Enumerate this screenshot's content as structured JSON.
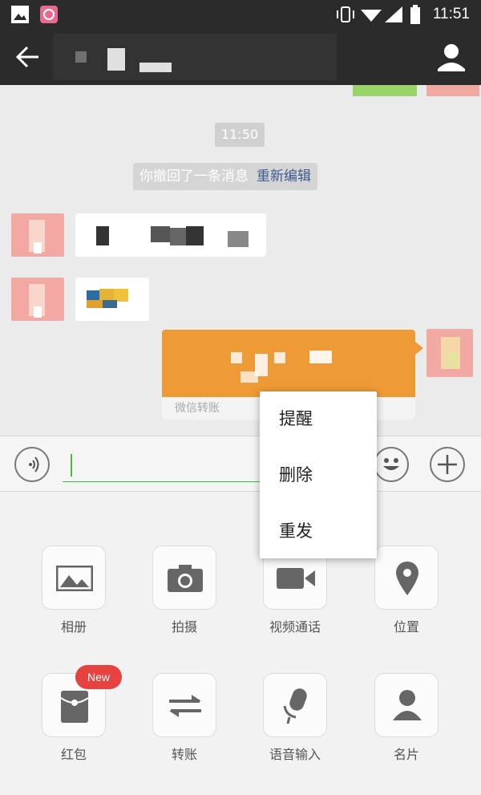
{
  "status_bar": {
    "time": "11:51",
    "icons": [
      "image-icon",
      "app-icon",
      "vibrate-icon",
      "wifi-icon",
      "signal-icon",
      "battery-icon"
    ]
  },
  "title_bar": {
    "icons": [
      "back-arrow-icon",
      "contact-profile-icon"
    ]
  },
  "chat": {
    "timestamp": "11:50",
    "recall_notice": "你撤回了一条消息",
    "reedit_link": "重新编辑",
    "transfer_footer": "微信转账"
  },
  "input_bar": {
    "value": "",
    "icons": [
      "voice-icon",
      "emoji-icon",
      "plus-icon"
    ]
  },
  "panel": {
    "items": [
      {
        "label": "相册",
        "icon": "photo-album-icon"
      },
      {
        "label": "拍摄",
        "icon": "camera-icon"
      },
      {
        "label": "视频通话",
        "icon": "video-call-icon"
      },
      {
        "label": "位置",
        "icon": "location-pin-icon"
      },
      {
        "label": "红包",
        "icon": "red-packet-icon"
      },
      {
        "label": "转账",
        "icon": "transfer-arrows-icon"
      },
      {
        "label": "语音输入",
        "icon": "microphone-icon"
      },
      {
        "label": "名片",
        "icon": "contact-card-icon"
      }
    ],
    "new_badge": "New"
  },
  "context_menu": {
    "items": [
      "提醒",
      "删除",
      "重发"
    ]
  },
  "colors": {
    "bar_dark": "#2b2b2b",
    "accent_green": "#48b93f",
    "transfer_orange": "#ee9a36",
    "badge_red": "#e64340",
    "link_blue": "#3e5a8e"
  }
}
